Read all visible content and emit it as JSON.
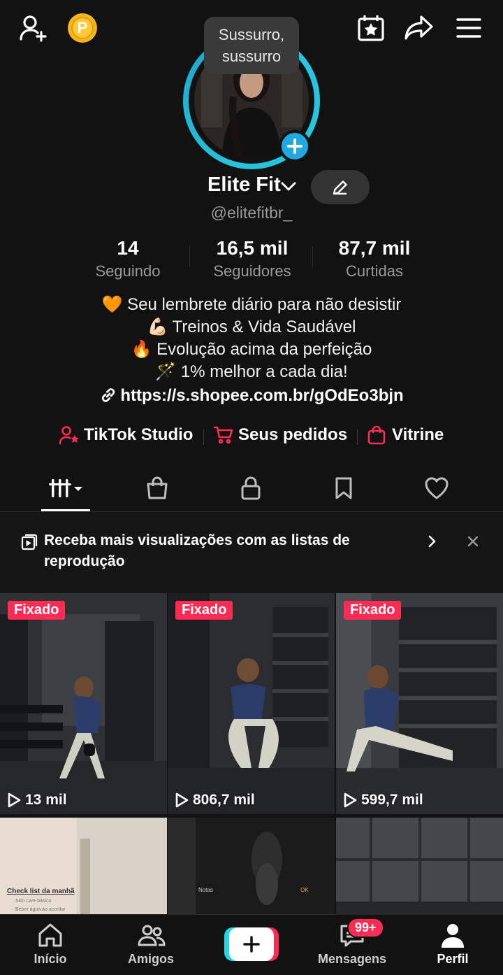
{
  "tooltip": "Sussurro, sussurro",
  "profile": {
    "name": "Elite Fit",
    "handle": "@elitefitbr_"
  },
  "stats": [
    {
      "value": "14",
      "label": "Seguindo"
    },
    {
      "value": "16,5 mil",
      "label": "Seguidores"
    },
    {
      "value": "87,7 mil",
      "label": "Curtidas"
    }
  ],
  "bio": [
    "🧡 Seu lembrete diário para não desistir",
    "💪🏻 Treinos & Vida Saudável",
    "🔥 Evolução acima da perfeição",
    "🪄 1% melhor a cada dia!"
  ],
  "link": "https://s.shopee.com.br/gOdEo3bjn",
  "actions": {
    "studio": "TikTok Studio",
    "orders": "Seus pedidos",
    "showcase": "Vitrine"
  },
  "playlist_banner": "Receba mais visualizações com as listas de reprodução",
  "videos": [
    {
      "pinned": "Fixado",
      "views": "13 mil"
    },
    {
      "pinned": "Fixado",
      "views": "806,7 mil"
    },
    {
      "pinned": "Fixado",
      "views": "599,7 mil"
    }
  ],
  "row2": {
    "checklist_title": "Check list da manhã",
    "checklist_item1": "Skin care básico",
    "checklist_item2": "Beber água ao acordar",
    "notes_back": "Notas",
    "notes_ok": "OK"
  },
  "nav": {
    "home": "Início",
    "friends": "Amigos",
    "messages": "Mensagens",
    "profile": "Perfil",
    "messages_badge": "99+"
  },
  "colors": {
    "accent": "#fe2c55",
    "cyan": "#20d5ec",
    "background": "#121212"
  }
}
